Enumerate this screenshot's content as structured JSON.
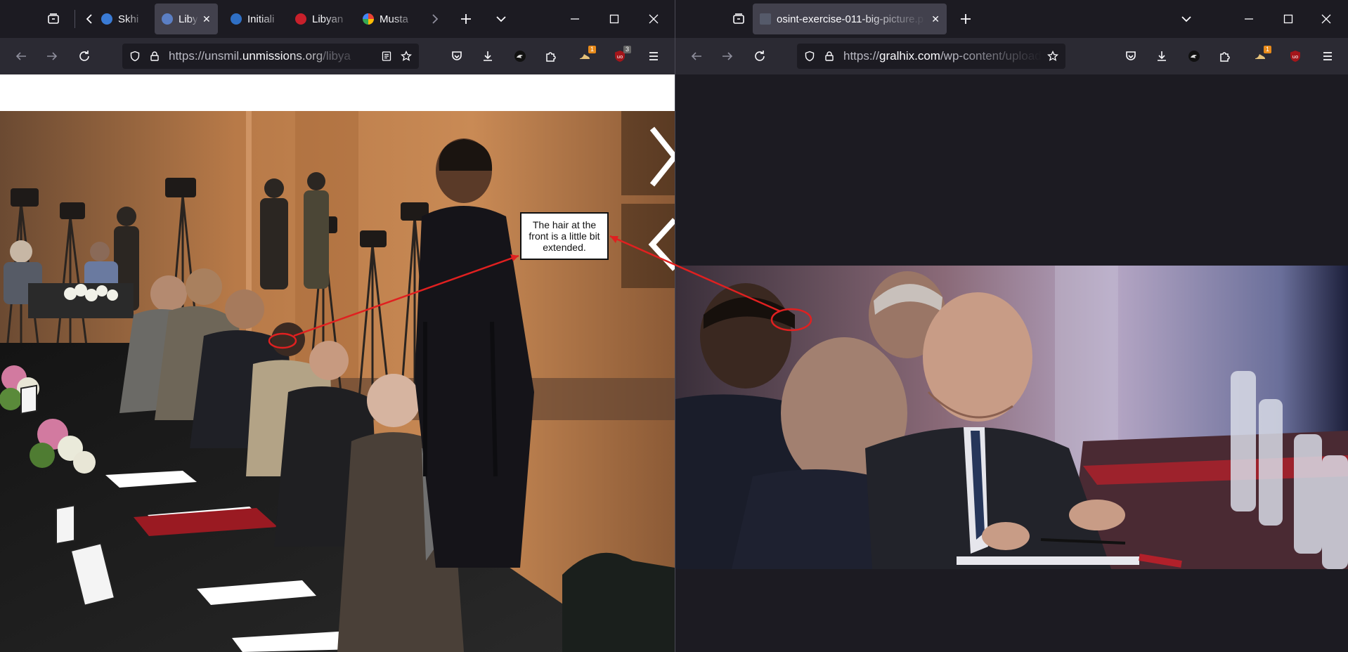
{
  "left_window": {
    "tabs": [
      {
        "label": "Skhira",
        "active": false
      },
      {
        "label": "Liby",
        "active": true
      },
      {
        "label": "Initiali",
        "active": false
      },
      {
        "label": "Libyan",
        "active": false
      },
      {
        "label": "Musta",
        "active": false
      }
    ],
    "url_prefix": "https://unsmil.",
    "url_domain": "unmissions.org",
    "url_suffix": "/libya",
    "badges": {
      "extension_badge": "1",
      "ublock_badge": "3"
    }
  },
  "right_window": {
    "tabs": [
      {
        "label": "osint-exercise-011-big-picture.p",
        "active": true
      }
    ],
    "url_prefix": "https://",
    "url_domain": "gralhix.com",
    "url_suffix": "/wp-content/uploads",
    "badges": {
      "extension_badge": "1"
    }
  },
  "annotation": {
    "text": "The hair at the front is a little bit extended.",
    "color": "#e02020"
  },
  "colors": {
    "tabstrip_bg": "#1c1b22",
    "toolbar_bg": "#2b2a33",
    "urlbar_bg": "#1c1b22",
    "active_tab_bg": "#42414d",
    "ublock_red": "#a3151a",
    "badge_orange": "#e88a1a"
  }
}
